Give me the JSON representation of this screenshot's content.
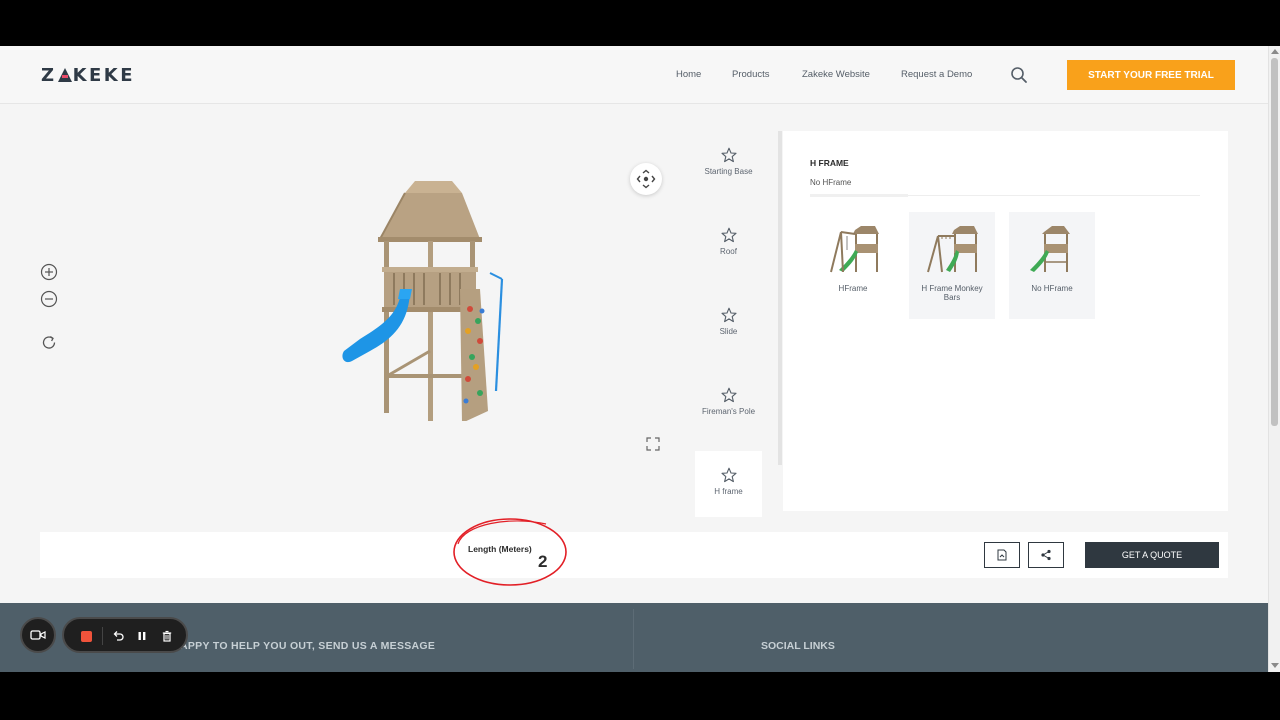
{
  "brand": {
    "logo_text_left": "Z",
    "logo_text_right": "KEKE",
    "accent": "#f9a11b",
    "dark": "#2f3840"
  },
  "nav": {
    "items": [
      "Home",
      "Products",
      "Zakeke Website",
      "Request a Demo"
    ],
    "trial_label": "START YOUR FREE TRIAL"
  },
  "steps": [
    {
      "label": "Starting Base",
      "icon": "star-icon"
    },
    {
      "label": "Roof",
      "icon": "star-icon"
    },
    {
      "label": "Slide",
      "icon": "star-icon"
    },
    {
      "label": "Fireman's Pole",
      "icon": "star-icon"
    },
    {
      "label": "H frame",
      "icon": "star-icon",
      "active": true
    }
  ],
  "panel": {
    "title": "H FRAME",
    "selected_value": "No HFrame",
    "options": [
      {
        "label": "HFrame"
      },
      {
        "label": "H Frame Monkey Bars",
        "hovered": true
      },
      {
        "label": "No HFrame"
      }
    ]
  },
  "bottom": {
    "length_label": "Length (Meters)",
    "length_value": "2",
    "quote_label": "GET A QUOTE"
  },
  "footer": {
    "left_heading": "APPY TO HELP YOU OUT, SEND US A MESSAGE",
    "right_heading": "SOCIAL LINKS"
  },
  "recorder": {
    "buttons": [
      "camera-icon",
      "stop-icon",
      "undo-icon",
      "pause-icon",
      "trash-icon"
    ]
  }
}
